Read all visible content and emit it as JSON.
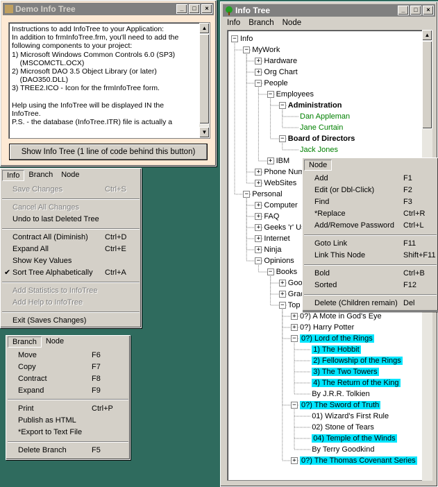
{
  "demo_window": {
    "title": "Demo Info Tree",
    "text_lines": [
      "Instructions to add InfoTree to your Application:",
      "In addition to frmInfoTree.frm, you'll need to add the",
      "following components to your project:",
      "1) Microsoft Windows Common Controls 6.0 (SP3)",
      "    (MSCOMCTL.OCX)",
      "2) Microsoft DAO 3.5 Object Library (or later)",
      "    (DAO350.DLL)",
      "3) TREE2.ICO - Icon for the frmInfoTree form.",
      "",
      "Help using the InfoTree will be displayed IN the",
      "InfoTree.",
      "P.S. - the database (InfoTree.ITR) file is actually a"
    ],
    "button_label": "Show Info Tree (1 line of code behind this button)"
  },
  "info_menu": {
    "menubar": [
      "Info",
      "Branch",
      "Node"
    ],
    "items": [
      {
        "label": "Save Changes",
        "key": "Ctrl+S",
        "disabled": true
      },
      {
        "label": "Cancel All Changes",
        "key": "",
        "disabled": true
      },
      {
        "label": "Undo to last Deleted Tree",
        "key": "",
        "disabled": false
      },
      {
        "label": "Contract All (Diminish)",
        "key": "Ctrl+D",
        "disabled": false
      },
      {
        "label": "Expand All",
        "key": "Ctrl+E",
        "disabled": false
      },
      {
        "label": "Show Key Values",
        "key": "",
        "disabled": false
      },
      {
        "label": "Sort Tree Alphabetically",
        "key": "Ctrl+A",
        "disabled": false,
        "checked": true
      },
      {
        "label": "Add Statistics to InfoTree",
        "key": "",
        "disabled": true
      },
      {
        "label": "Add Help to InfoTree",
        "key": "",
        "disabled": true
      },
      {
        "label": "Exit (Saves Changes)",
        "key": "",
        "disabled": false
      }
    ]
  },
  "branch_menu": {
    "menubar": [
      "Branch",
      "Node"
    ],
    "items": [
      {
        "label": "Move",
        "key": "F6"
      },
      {
        "label": "Copy",
        "key": "F7"
      },
      {
        "label": "Contract",
        "key": "F8"
      },
      {
        "label": "Expand",
        "key": "F9"
      },
      {
        "label": "Print",
        "key": "Ctrl+P"
      },
      {
        "label": "Publish as HTML",
        "key": ""
      },
      {
        "label": "*Export to Text File",
        "key": ""
      },
      {
        "label": "Delete Branch",
        "key": "F5"
      }
    ]
  },
  "tree_window": {
    "title": "Info Tree",
    "menubar": [
      "Info",
      "Branch",
      "Node"
    ],
    "nodes": [
      {
        "text": "Info"
      },
      {
        "text": "MyWork"
      },
      {
        "text": "Hardware"
      },
      {
        "text": "Org Chart"
      },
      {
        "text": "People"
      },
      {
        "text": "Employees"
      },
      {
        "text": "Administration"
      },
      {
        "text": "Dan Appleman"
      },
      {
        "text": "Jane Curtain"
      },
      {
        "text": "Board of Directors"
      },
      {
        "text": "Jack Jones"
      },
      {
        "text": "IBM"
      },
      {
        "text": "Phone Num"
      },
      {
        "text": "WebSites"
      },
      {
        "text": "Personal"
      },
      {
        "text": "Computer"
      },
      {
        "text": "FAQ"
      },
      {
        "text": "Geeks 'r' Us"
      },
      {
        "text": "Internet"
      },
      {
        "text": "Ninja"
      },
      {
        "text": "Opinions"
      },
      {
        "text": "Books"
      },
      {
        "text": "Goo"
      },
      {
        "text": "Grad"
      },
      {
        "text": "Top"
      },
      {
        "text": "0?) A Mote in God's Eye"
      },
      {
        "text": "0?) Harry Potter"
      },
      {
        "text": "0?) Lord of the Rings"
      },
      {
        "text": "1) The Hobbit"
      },
      {
        "text": "2) Fellowship of the Rings"
      },
      {
        "text": "3) The Two Towers"
      },
      {
        "text": "4) The Return of the King"
      },
      {
        "text": "By J.R.R. Tolkien"
      },
      {
        "text": "0?) The Sword of Truth"
      },
      {
        "text": "01) Wizard's First Rule"
      },
      {
        "text": "02) Stone of Tears"
      },
      {
        "text": "04) Temple of the Winds"
      },
      {
        "text": "By Terry Goodkind"
      },
      {
        "text": "0?) The Thomas Covenant Series"
      }
    ]
  },
  "node_menu": {
    "menubar": [
      "Node"
    ],
    "items": [
      {
        "label": "Add",
        "key": "F1"
      },
      {
        "label": "Edit (or Dbl-Click)",
        "key": "F2"
      },
      {
        "label": "Find",
        "key": "F3"
      },
      {
        "label": "*Replace",
        "key": "Ctrl+R"
      },
      {
        "label": "Add/Remove Password",
        "key": "Ctrl+L"
      },
      {
        "label": "Goto Link",
        "key": "F11"
      },
      {
        "label": "Link This Node",
        "key": "Shift+F11"
      },
      {
        "label": "Bold",
        "key": "Ctrl+B"
      },
      {
        "label": "Sorted",
        "key": "F12"
      },
      {
        "label": "Delete (Children remain)",
        "key": "Del"
      }
    ]
  },
  "colors": {
    "desktop": "#2f6b5e",
    "highlight": "#00e5ff",
    "green_text": "#008000",
    "demo_panel": "#fde9d4"
  }
}
